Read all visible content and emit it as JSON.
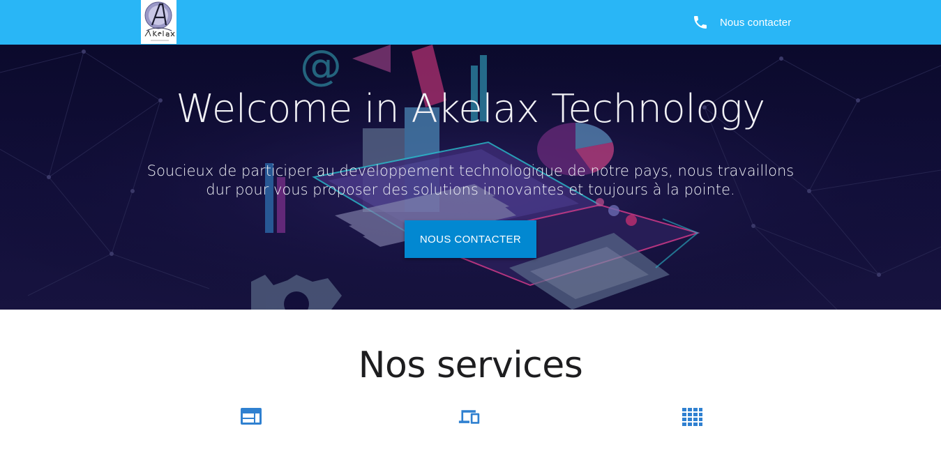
{
  "header": {
    "logo_text": "Akelax",
    "contact_label": "Nous contacter"
  },
  "hero": {
    "title": "Welcome in Akelax Technology",
    "subtitle": "Soucieux de participer au developpement technologique de notre pays, nous travaillons dur pour vous proposer des solutions innovantes et toujours à la pointe.",
    "cta_label": "NOUS CONTACTER"
  },
  "services": {
    "title": "Nos services",
    "icons": [
      "web-icon",
      "devices-icon",
      "apps-grid-icon"
    ]
  },
  "colors": {
    "topbar": "#29b6f6",
    "cta": "#0288d1",
    "service_icon": "#2f80d0",
    "hero_bg": "#0b0a2c"
  }
}
